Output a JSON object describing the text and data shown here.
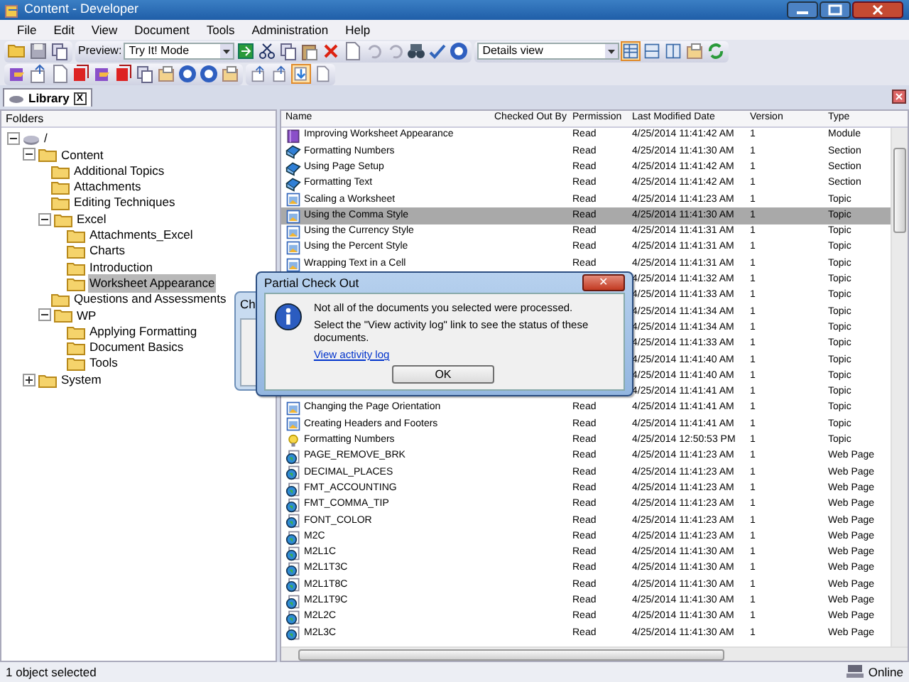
{
  "window": {
    "title": "Content - Developer"
  },
  "menu": [
    "File",
    "Edit",
    "View",
    "Document",
    "Tools",
    "Administration",
    "Help"
  ],
  "toolbar": {
    "preview_label": "Preview:",
    "preview_mode": "Try It! Mode",
    "view_mode": "Details view",
    "view_buttons": [
      {
        "selected": true
      },
      {
        "selected": false
      },
      {
        "selected": false
      }
    ],
    "row2_toggles": [
      {
        "selected": false
      },
      {
        "selected": false
      },
      {
        "selected": true
      },
      {
        "selected": false
      }
    ]
  },
  "tabs": [
    {
      "label": "Library",
      "close": "X",
      "selected": true
    }
  ],
  "folders": {
    "heading": "Folders",
    "tree": [
      {
        "label": "/",
        "kind": "drive",
        "expanded": true,
        "selected": false,
        "children": [
          {
            "label": "Content",
            "kind": "folder",
            "expanded": true,
            "selected": false,
            "children": [
              {
                "label": "Additional Topics",
                "kind": "folder",
                "selected": false
              },
              {
                "label": "Attachments",
                "kind": "folder",
                "selected": false
              },
              {
                "label": "Editing Techniques",
                "kind": "folder",
                "selected": false
              },
              {
                "label": "Excel",
                "kind": "folder",
                "expanded": true,
                "selected": false,
                "children": [
                  {
                    "label": "Attachments_Excel",
                    "kind": "folder",
                    "selected": false
                  },
                  {
                    "label": "Charts",
                    "kind": "folder",
                    "selected": false
                  },
                  {
                    "label": "Introduction",
                    "kind": "folder",
                    "selected": false
                  },
                  {
                    "label": "Worksheet Appearance",
                    "kind": "folder",
                    "selected": true
                  }
                ]
              },
              {
                "label": "Questions and Assessments",
                "kind": "folder",
                "selected": false
              },
              {
                "label": "WP",
                "kind": "folder",
                "expanded": true,
                "selected": false,
                "children": [
                  {
                    "label": "Applying Formatting",
                    "kind": "folder",
                    "selected": false
                  },
                  {
                    "label": "Document Basics",
                    "kind": "folder",
                    "selected": false
                  },
                  {
                    "label": "Tools",
                    "kind": "folder",
                    "selected": false
                  }
                ]
              }
            ]
          },
          {
            "label": "System",
            "kind": "folder",
            "expanded": false,
            "selected": false
          }
        ]
      }
    ]
  },
  "table": {
    "columns": [
      "Name",
      "Checked Out By",
      "Permission",
      "Last Modified Date",
      "Version",
      "Type"
    ],
    "rows": [
      {
        "kind": "module",
        "name": "Improving Worksheet Appearance",
        "permission": "Read",
        "modified": "4/25/2014 11:41:42 AM",
        "version": "1",
        "type": "Module",
        "selected": false
      },
      {
        "kind": "section",
        "name": "Formatting Numbers",
        "permission": "Read",
        "modified": "4/25/2014 11:41:30 AM",
        "version": "1",
        "type": "Section",
        "selected": false
      },
      {
        "kind": "section",
        "name": "Using Page Setup",
        "permission": "Read",
        "modified": "4/25/2014 11:41:42 AM",
        "version": "1",
        "type": "Section",
        "selected": false
      },
      {
        "kind": "section",
        "name": "Formatting Text",
        "permission": "Read",
        "modified": "4/25/2014 11:41:42 AM",
        "version": "1",
        "type": "Section",
        "selected": false
      },
      {
        "kind": "topic",
        "name": "Scaling a Worksheet",
        "permission": "Read",
        "modified": "4/25/2014 11:41:23 AM",
        "version": "1",
        "type": "Topic",
        "selected": false
      },
      {
        "kind": "topic",
        "name": "Using the Comma Style",
        "permission": "Read",
        "modified": "4/25/2014 11:41:30 AM",
        "version": "1",
        "type": "Topic",
        "selected": true
      },
      {
        "kind": "topic",
        "name": "Using the Currency Style",
        "permission": "Read",
        "modified": "4/25/2014 11:41:31 AM",
        "version": "1",
        "type": "Topic",
        "selected": false
      },
      {
        "kind": "topic",
        "name": "Using the Percent Style",
        "permission": "Read",
        "modified": "4/25/2014 11:41:31 AM",
        "version": "1",
        "type": "Topic",
        "selected": false
      },
      {
        "kind": "topic",
        "name": "Wrapping Text in a Cell",
        "permission": "Read",
        "modified": "4/25/2014 11:41:31 AM",
        "version": "1",
        "type": "Topic",
        "selected": false
      },
      {
        "kind": "hidden",
        "modified": "4/25/2014 11:41:32 AM",
        "version": "1",
        "type": "Topic",
        "selected": false
      },
      {
        "kind": "hidden",
        "modified": "4/25/2014 11:41:33 AM",
        "version": "1",
        "type": "Topic",
        "selected": false
      },
      {
        "kind": "hidden",
        "modified": "4/25/2014 11:41:34 AM",
        "version": "1",
        "type": "Topic",
        "selected": false
      },
      {
        "kind": "hidden",
        "modified": "4/25/2014 11:41:34 AM",
        "version": "1",
        "type": "Topic",
        "selected": false
      },
      {
        "kind": "hidden",
        "modified": "4/25/2014 11:41:33 AM",
        "version": "1",
        "type": "Topic",
        "selected": false
      },
      {
        "kind": "hidden",
        "modified": "4/25/2014 11:41:40 AM",
        "version": "1",
        "type": "Topic",
        "selected": false
      },
      {
        "kind": "hidden",
        "modified": "4/25/2014 11:41:40 AM",
        "version": "1",
        "type": "Topic",
        "selected": false
      },
      {
        "kind": "hidden",
        "modified": "4/25/2014 11:41:41 AM",
        "version": "1",
        "type": "Topic",
        "selected": false
      },
      {
        "kind": "topic",
        "name": "Changing the Page Orientation",
        "permission": "Read",
        "modified": "4/25/2014 11:41:41 AM",
        "version": "1",
        "type": "Topic",
        "selected": false
      },
      {
        "kind": "topic",
        "name": "Creating Headers and Footers",
        "permission": "Read",
        "modified": "4/25/2014 11:41:41 AM",
        "version": "1",
        "type": "Topic",
        "selected": false
      },
      {
        "kind": "bulb",
        "name": "Formatting Numbers",
        "permission": "Read",
        "modified": "4/25/2014 12:50:53 PM",
        "version": "1",
        "type": "Topic",
        "selected": false
      },
      {
        "kind": "web",
        "name": "PAGE_REMOVE_BRK",
        "permission": "Read",
        "modified": "4/25/2014 11:41:23 AM",
        "version": "1",
        "type": "Web Page",
        "selected": false
      },
      {
        "kind": "web",
        "name": "DECIMAL_PLACES",
        "permission": "Read",
        "modified": "4/25/2014 11:41:23 AM",
        "version": "1",
        "type": "Web Page",
        "selected": false
      },
      {
        "kind": "web",
        "name": "FMT_ACCOUNTING",
        "permission": "Read",
        "modified": "4/25/2014 11:41:23 AM",
        "version": "1",
        "type": "Web Page",
        "selected": false
      },
      {
        "kind": "web",
        "name": "FMT_COMMA_TIP",
        "permission": "Read",
        "modified": "4/25/2014 11:41:23 AM",
        "version": "1",
        "type": "Web Page",
        "selected": false
      },
      {
        "kind": "web",
        "name": "FONT_COLOR",
        "permission": "Read",
        "modified": "4/25/2014 11:41:23 AM",
        "version": "1",
        "type": "Web Page",
        "selected": false
      },
      {
        "kind": "web",
        "name": "M2C",
        "permission": "Read",
        "modified": "4/25/2014 11:41:23 AM",
        "version": "1",
        "type": "Web Page",
        "selected": false
      },
      {
        "kind": "web",
        "name": "M2L1C",
        "permission": "Read",
        "modified": "4/25/2014 11:41:30 AM",
        "version": "1",
        "type": "Web Page",
        "selected": false
      },
      {
        "kind": "web",
        "name": "M2L1T3C",
        "permission": "Read",
        "modified": "4/25/2014 11:41:30 AM",
        "version": "1",
        "type": "Web Page",
        "selected": false
      },
      {
        "kind": "web",
        "name": "M2L1T8C",
        "permission": "Read",
        "modified": "4/25/2014 11:41:30 AM",
        "version": "1",
        "type": "Web Page",
        "selected": false
      },
      {
        "kind": "web",
        "name": "M2L1T9C",
        "permission": "Read",
        "modified": "4/25/2014 11:41:30 AM",
        "version": "1",
        "type": "Web Page",
        "selected": false
      },
      {
        "kind": "web",
        "name": "M2L2C",
        "permission": "Read",
        "modified": "4/25/2014 11:41:30 AM",
        "version": "1",
        "type": "Web Page",
        "selected": false
      },
      {
        "kind": "web",
        "name": "M2L3C",
        "permission": "Read",
        "modified": "4/25/2014 11:41:30 AM",
        "version": "1",
        "type": "Web Page",
        "selected": false
      }
    ]
  },
  "back_dialog": {
    "title": "Ch"
  },
  "dialog": {
    "title": "Partial Check Out",
    "close": "✕",
    "message": "Not all of the documents you selected were processed.",
    "detail": "Select the \"View activity log\" link to see the status of these documents.",
    "link": "View activity log",
    "button": "OK"
  },
  "status_bar": {
    "text": "1 object selected",
    "connection": "Online"
  }
}
